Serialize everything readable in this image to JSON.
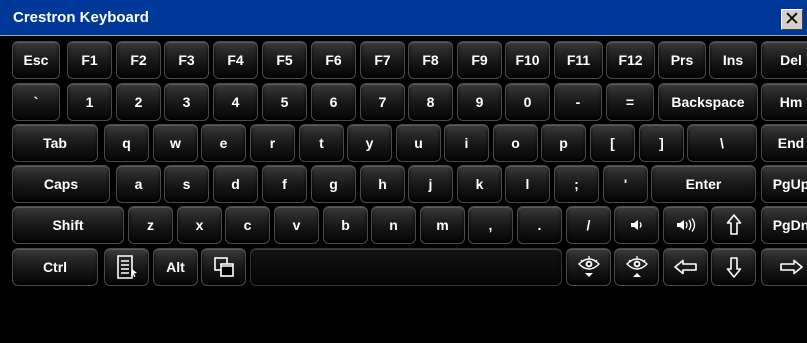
{
  "window": {
    "title": "Crestron Keyboard",
    "close_label": "✕"
  },
  "rows": [
    [
      {
        "name": "esc",
        "label": "Esc"
      },
      {
        "name": "f1",
        "label": "F1"
      },
      {
        "name": "f2",
        "label": "F2"
      },
      {
        "name": "f3",
        "label": "F3"
      },
      {
        "name": "f4",
        "label": "F4"
      },
      {
        "name": "f5",
        "label": "F5"
      },
      {
        "name": "f6",
        "label": "F6"
      },
      {
        "name": "f7",
        "label": "F7"
      },
      {
        "name": "f8",
        "label": "F8"
      },
      {
        "name": "f9",
        "label": "F9"
      },
      {
        "name": "f10",
        "label": "F10"
      },
      {
        "name": "f11",
        "label": "F11"
      },
      {
        "name": "f12",
        "label": "F12"
      },
      {
        "name": "prs",
        "label": "Prs"
      },
      {
        "name": "ins",
        "label": "Ins"
      },
      {
        "name": "del",
        "label": "Del"
      }
    ],
    [
      {
        "name": "backtick",
        "label": "`"
      },
      {
        "name": "1",
        "label": "1"
      },
      {
        "name": "2",
        "label": "2"
      },
      {
        "name": "3",
        "label": "3"
      },
      {
        "name": "4",
        "label": "4"
      },
      {
        "name": "5",
        "label": "5"
      },
      {
        "name": "6",
        "label": "6"
      },
      {
        "name": "7",
        "label": "7"
      },
      {
        "name": "8",
        "label": "8"
      },
      {
        "name": "9",
        "label": "9"
      },
      {
        "name": "0",
        "label": "0"
      },
      {
        "name": "minus",
        "label": "-"
      },
      {
        "name": "equals",
        "label": "="
      },
      {
        "name": "backspace",
        "label": "Backspace"
      },
      {
        "name": "home",
        "label": "Hm"
      }
    ],
    [
      {
        "name": "tab",
        "label": "Tab"
      },
      {
        "name": "q",
        "label": "q"
      },
      {
        "name": "w",
        "label": "w"
      },
      {
        "name": "e",
        "label": "e"
      },
      {
        "name": "r",
        "label": "r"
      },
      {
        "name": "t",
        "label": "t"
      },
      {
        "name": "y",
        "label": "y"
      },
      {
        "name": "u",
        "label": "u"
      },
      {
        "name": "i",
        "label": "i"
      },
      {
        "name": "o",
        "label": "o"
      },
      {
        "name": "p",
        "label": "p"
      },
      {
        "name": "lbracket",
        "label": "["
      },
      {
        "name": "rbracket",
        "label": "]"
      },
      {
        "name": "backslash",
        "label": "\\"
      },
      {
        "name": "end",
        "label": "End"
      }
    ],
    [
      {
        "name": "caps",
        "label": "Caps"
      },
      {
        "name": "a",
        "label": "a"
      },
      {
        "name": "s",
        "label": "s"
      },
      {
        "name": "d",
        "label": "d"
      },
      {
        "name": "f",
        "label": "f"
      },
      {
        "name": "g",
        "label": "g"
      },
      {
        "name": "h",
        "label": "h"
      },
      {
        "name": "j",
        "label": "j"
      },
      {
        "name": "k",
        "label": "k"
      },
      {
        "name": "l",
        "label": "l"
      },
      {
        "name": "semicolon",
        "label": ";"
      },
      {
        "name": "quote",
        "label": "'"
      },
      {
        "name": "enter",
        "label": "Enter"
      },
      {
        "name": "pgup",
        "label": "PgUp"
      }
    ],
    [
      {
        "name": "shift",
        "label": "Shift"
      },
      {
        "name": "z",
        "label": "z"
      },
      {
        "name": "x",
        "label": "x"
      },
      {
        "name": "c",
        "label": "c"
      },
      {
        "name": "v",
        "label": "v"
      },
      {
        "name": "b",
        "label": "b"
      },
      {
        "name": "n",
        "label": "n"
      },
      {
        "name": "m",
        "label": "m"
      },
      {
        "name": "comma",
        "label": ","
      },
      {
        "name": "period",
        "label": "."
      },
      {
        "name": "slash",
        "label": "/"
      },
      {
        "name": "volume-down",
        "icon": "volume-down-icon"
      },
      {
        "name": "volume-up",
        "icon": "volume-up-icon"
      },
      {
        "name": "arrow-up",
        "icon": "arrow-up-icon"
      },
      {
        "name": "pgdn",
        "label": "PgDn"
      }
    ],
    [
      {
        "name": "ctrl",
        "label": "Ctrl"
      },
      {
        "name": "context-menu",
        "icon": "context-menu-icon"
      },
      {
        "name": "alt",
        "label": "Alt"
      },
      {
        "name": "window-switch",
        "icon": "window-switch-icon"
      },
      {
        "name": "space",
        "label": ""
      },
      {
        "name": "hide-keyboard",
        "icon": "eye-hide-icon"
      },
      {
        "name": "show-keyboard",
        "icon": "eye-show-icon"
      },
      {
        "name": "arrow-left",
        "icon": "arrow-left-icon"
      },
      {
        "name": "arrow-down",
        "icon": "arrow-down-icon"
      },
      {
        "name": "arrow-right",
        "icon": "arrow-right-icon"
      }
    ]
  ]
}
